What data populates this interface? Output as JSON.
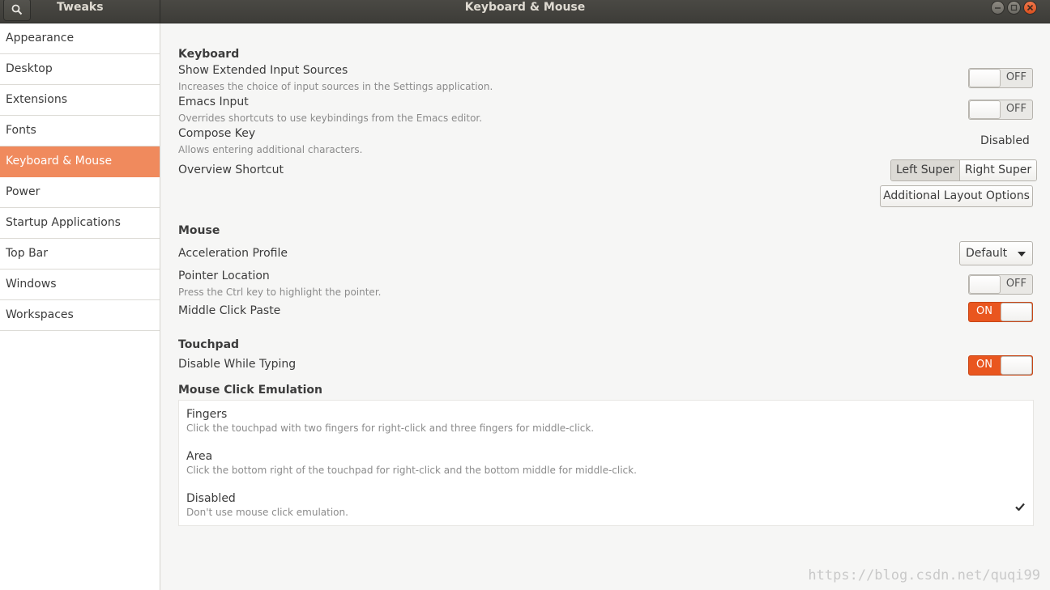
{
  "header": {
    "app_title": "Tweaks",
    "window_title": "Keyboard & Mouse",
    "search_icon": "search-icon",
    "wm_buttons": [
      "minimize-icon",
      "maximize-icon",
      "close-icon"
    ]
  },
  "sidebar": {
    "items": [
      {
        "label": "Appearance"
      },
      {
        "label": "Desktop"
      },
      {
        "label": "Extensions"
      },
      {
        "label": "Fonts"
      },
      {
        "label": "Keyboard & Mouse"
      },
      {
        "label": "Power"
      },
      {
        "label": "Startup Applications"
      },
      {
        "label": "Top Bar"
      },
      {
        "label": "Windows"
      },
      {
        "label": "Workspaces"
      }
    ],
    "selected": "Keyboard & Mouse"
  },
  "keyboard": {
    "title": "Keyboard",
    "extended_sources": {
      "title": "Show Extended Input Sources",
      "desc": "Increases the choice of input sources in the Settings application.",
      "state": "OFF"
    },
    "emacs": {
      "title": "Emacs Input",
      "desc": "Overrides shortcuts to use keybindings from the Emacs editor.",
      "state": "OFF"
    },
    "compose": {
      "title": "Compose Key",
      "desc": "Allows entering additional characters.",
      "value": "Disabled"
    },
    "overview": {
      "title": "Overview Shortcut",
      "left": "Left Super",
      "right": "Right Super"
    },
    "layout_button": "Additional Layout Options"
  },
  "mouse": {
    "title": "Mouse",
    "accel": {
      "title": "Acceleration Profile",
      "value": "Default"
    },
    "pointer": {
      "title": "Pointer Location",
      "desc": "Press the Ctrl key to highlight the pointer.",
      "state": "OFF"
    },
    "middle": {
      "title": "Middle Click Paste",
      "state": "ON"
    }
  },
  "touchpad": {
    "title": "Touchpad",
    "disable_typing": {
      "title": "Disable While Typing",
      "state": "ON"
    }
  },
  "emulation": {
    "title": "Mouse Click Emulation",
    "options": [
      {
        "title": "Fingers",
        "desc": "Click the touchpad with two fingers for right-click and three fingers for middle-click."
      },
      {
        "title": "Area",
        "desc": "Click the bottom right of the touchpad for right-click and the bottom middle for middle-click."
      },
      {
        "title": "Disabled",
        "desc": "Don't use mouse click emulation."
      }
    ],
    "selected": "Disabled"
  },
  "watermark": "https://blog.csdn.net/quqi99",
  "colors": {
    "accent": "#f08a5d",
    "switch_on": "#e9561f",
    "headerbar": "#3d3c38"
  }
}
